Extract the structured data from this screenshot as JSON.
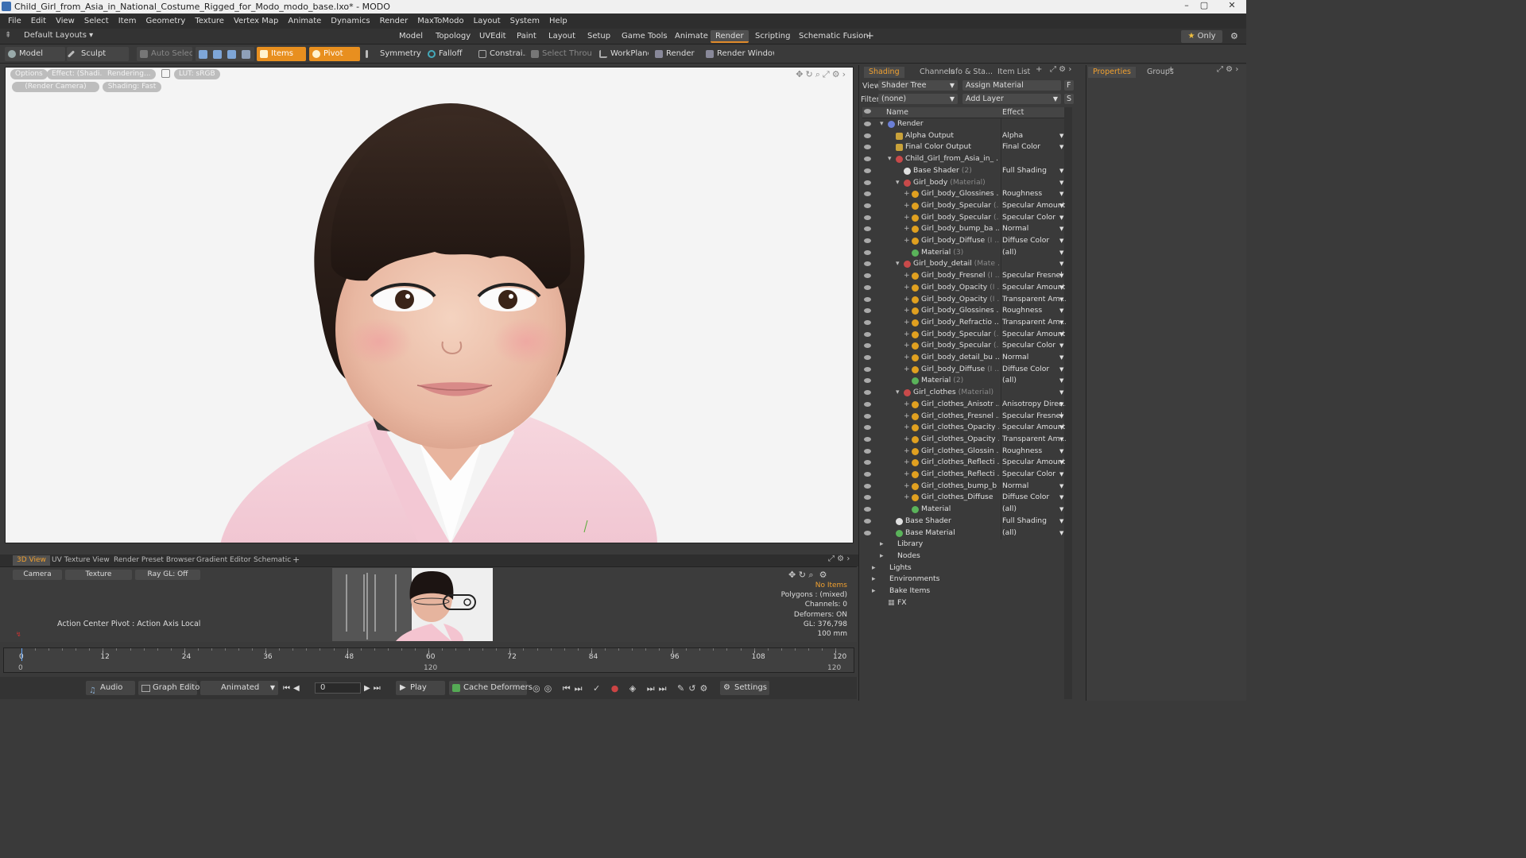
{
  "window": {
    "title": "Child_Girl_from_Asia_in_National_Costume_Rigged_for_Modo_modo_base.lxo* - MODO"
  },
  "menu": [
    "File",
    "Edit",
    "View",
    "Select",
    "Item",
    "Geometry",
    "Texture",
    "Vertex Map",
    "Animate",
    "Dynamics",
    "Render",
    "MaxToModo",
    "Layout",
    "System",
    "Help"
  ],
  "layoutbar": {
    "preset": "Default Layouts",
    "tabs": [
      "Model",
      "Topology",
      "UVEdit",
      "Paint",
      "Layout",
      "Setup",
      "Game Tools",
      "Animate",
      "Render",
      "Scripting",
      "Schematic Fusion"
    ],
    "active_tab": "Render",
    "add": "+",
    "only": "Only"
  },
  "toolbar": {
    "model": "Model",
    "sculpt": "Sculpt",
    "auto_select": "Auto Select",
    "items": "Items",
    "pivot": "Pivot",
    "symmetry": "Symmetry",
    "falloff": "Falloff",
    "constraints": "Constrai...",
    "select_through": "Select Through",
    "workplane": "WorkPlane",
    "render": "Render",
    "render_window": "Render Window"
  },
  "viewport": {
    "options": "Options",
    "effect": "Effect: (Shadi...",
    "rendering": "Rendering...",
    "lut": "LUT: sRGB",
    "camera": "(Render Camera)",
    "shading": "Shading: Fast"
  },
  "bottom_tabs": [
    "3D View",
    "UV Texture View",
    "Render Preset Browser",
    "Gradient Editor",
    "Schematic"
  ],
  "bottom_panel": {
    "camera": "Camera",
    "texture": "Texture",
    "raygl": "Ray GL: Off",
    "action_center": "Action Center Pivot : Action Axis Local",
    "stats": [
      "No Items",
      "Polygons : (mixed)",
      "Channels: 0",
      "Deformers: ON",
      "GL: 376,798",
      "100 mm"
    ]
  },
  "timeline": {
    "ticks": [
      "0",
      "12",
      "24",
      "36",
      "48",
      "60",
      "72",
      "84",
      "96",
      "108",
      "120"
    ],
    "sub_start": "0",
    "sub_mid": "120",
    "sub_end": "120"
  },
  "transport": {
    "audio": "Audio",
    "graph_editor": "Graph Editor",
    "mode": "Animated",
    "frame": "0",
    "play": "Play",
    "cache": "Cache Deformers",
    "settings": "Settings"
  },
  "shading_panel": {
    "tabs": [
      "Shading",
      "Channels",
      "Info & Sta...",
      "Item List"
    ],
    "view_label": "View",
    "view_value": "Shader Tree",
    "assign": "Assign Material",
    "f_btn": "F",
    "filter_label": "Filter",
    "filter_value": "(none)",
    "add_layer": "Add Layer",
    "s_btn": "S",
    "col_name": "Name",
    "col_effect": "Effect",
    "rows": [
      {
        "indent": 0,
        "name": "Render",
        "sub": "",
        "effect": "",
        "icon": "render"
      },
      {
        "indent": 1,
        "name": "Alpha Output",
        "sub": "",
        "effect": "Alpha",
        "icon": "output"
      },
      {
        "indent": 1,
        "name": "Final Color Output",
        "sub": "",
        "effect": "Final Color",
        "icon": "output"
      },
      {
        "indent": 1,
        "name": "Child_Girl_from_Asia_in_ ...",
        "sub": "",
        "effect": "",
        "icon": "group"
      },
      {
        "indent": 2,
        "name": "Base Shader",
        "sub": "(2)",
        "effect": "Full Shading",
        "icon": "shader"
      },
      {
        "indent": 2,
        "name": "Girl_body",
        "sub": "(Material)",
        "effect": "",
        "icon": "group"
      },
      {
        "indent": 3,
        "name": "Girl_body_Glossines ...",
        "sub": "",
        "effect": "Roughness",
        "icon": "tex"
      },
      {
        "indent": 3,
        "name": "Girl_body_Specular",
        "sub": "(...",
        "effect": "Specular Amount",
        "icon": "tex"
      },
      {
        "indent": 3,
        "name": "Girl_body_Specular",
        "sub": "(...",
        "effect": "Specular Color",
        "icon": "tex"
      },
      {
        "indent": 3,
        "name": "Girl_body_bump_ba ...",
        "sub": "",
        "effect": "Normal",
        "icon": "tex"
      },
      {
        "indent": 3,
        "name": "Girl_body_Diffuse",
        "sub": "(I ...",
        "effect": "Diffuse Color",
        "icon": "tex"
      },
      {
        "indent": 3,
        "name": "Material",
        "sub": "(3)",
        "effect": "(all)",
        "icon": "mat"
      },
      {
        "indent": 2,
        "name": "Girl_body_detail",
        "sub": "(Mate ...",
        "effect": "",
        "icon": "group"
      },
      {
        "indent": 3,
        "name": "Girl_body_Fresnel",
        "sub": "(I ...",
        "effect": "Specular Fresnel",
        "icon": "tex"
      },
      {
        "indent": 3,
        "name": "Girl_body_Opacity",
        "sub": "(I ...",
        "effect": "Specular Amount",
        "icon": "tex"
      },
      {
        "indent": 3,
        "name": "Girl_body_Opacity",
        "sub": "(I ...",
        "effect": "Transparent Am ...",
        "icon": "tex"
      },
      {
        "indent": 3,
        "name": "Girl_body_Glossines ...",
        "sub": "",
        "effect": "Roughness",
        "icon": "tex"
      },
      {
        "indent": 3,
        "name": "Girl_body_Refractio ...",
        "sub": "",
        "effect": "Transparent Am ...",
        "icon": "tex"
      },
      {
        "indent": 3,
        "name": "Girl_body_Specular",
        "sub": "(...",
        "effect": "Specular Amount",
        "icon": "tex"
      },
      {
        "indent": 3,
        "name": "Girl_body_Specular",
        "sub": "(...",
        "effect": "Specular Color",
        "icon": "tex"
      },
      {
        "indent": 3,
        "name": "Girl_body_detail_bu ...",
        "sub": "",
        "effect": "Normal",
        "icon": "tex"
      },
      {
        "indent": 3,
        "name": "Girl_body_Diffuse",
        "sub": "(I ...",
        "effect": "Diffuse Color",
        "icon": "tex"
      },
      {
        "indent": 3,
        "name": "Material",
        "sub": "(2)",
        "effect": "(all)",
        "icon": "mat"
      },
      {
        "indent": 2,
        "name": "Girl_clothes",
        "sub": "(Material)",
        "effect": "",
        "icon": "group"
      },
      {
        "indent": 3,
        "name": "Girl_clothes_Anisotr ...",
        "sub": "",
        "effect": "Anisotropy Direc...",
        "icon": "tex"
      },
      {
        "indent": 3,
        "name": "Girl_clothes_Fresnel ...",
        "sub": "",
        "effect": "Specular Fresnel",
        "icon": "tex"
      },
      {
        "indent": 3,
        "name": "Girl_clothes_Opacity ...",
        "sub": "",
        "effect": "Specular Amount",
        "icon": "tex"
      },
      {
        "indent": 3,
        "name": "Girl_clothes_Opacity ...",
        "sub": "",
        "effect": "Transparent Am ...",
        "icon": "tex"
      },
      {
        "indent": 3,
        "name": "Girl_clothes_Glossin ...",
        "sub": "",
        "effect": "Roughness",
        "icon": "tex"
      },
      {
        "indent": 3,
        "name": "Girl_clothes_Reflecti ...",
        "sub": "",
        "effect": "Specular Amount",
        "icon": "tex"
      },
      {
        "indent": 3,
        "name": "Girl_clothes_Reflecti ...",
        "sub": "",
        "effect": "Specular Color",
        "icon": "tex"
      },
      {
        "indent": 3,
        "name": "Girl_clothes_bump_b ...",
        "sub": "",
        "effect": "Normal",
        "icon": "tex"
      },
      {
        "indent": 3,
        "name": "Girl_clothes_Diffuse",
        "sub": "",
        "effect": "Diffuse Color",
        "icon": "tex"
      },
      {
        "indent": 3,
        "name": "Material",
        "sub": "",
        "effect": "(all)",
        "icon": "mat"
      },
      {
        "indent": 1,
        "name": "Base Shader",
        "sub": "",
        "effect": "Full Shading",
        "icon": "shader"
      },
      {
        "indent": 1,
        "name": "Base Material",
        "sub": "",
        "effect": "(all)",
        "icon": "mat"
      },
      {
        "indent": 0,
        "name": "Library",
        "sub": "",
        "effect": "",
        "icon": "folder"
      },
      {
        "indent": 0,
        "name": "Nodes",
        "sub": "",
        "effect": "",
        "icon": "folder"
      },
      {
        "indent": -1,
        "name": "Lights",
        "sub": "",
        "effect": "",
        "icon": "none"
      },
      {
        "indent": -1,
        "name": "Environments",
        "sub": "",
        "effect": "",
        "icon": "none"
      },
      {
        "indent": -1,
        "name": "Bake Items",
        "sub": "",
        "effect": "",
        "icon": "none"
      },
      {
        "indent": 0,
        "name": "FX",
        "sub": "",
        "effect": "",
        "icon": "fx"
      }
    ]
  },
  "properties_panel": {
    "tabs": [
      "Properties",
      "Groups"
    ]
  },
  "colors": {
    "accent": "#e88f1f",
    "panel": "#3a3a3a",
    "viewport_bg": "#f4f4f4"
  }
}
